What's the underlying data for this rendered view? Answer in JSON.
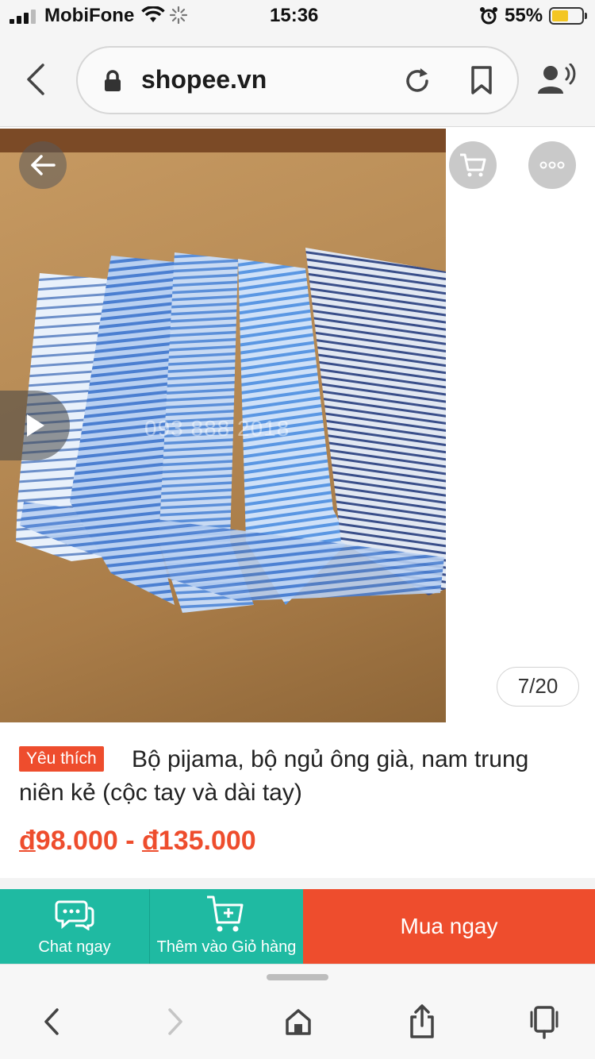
{
  "status_bar": {
    "carrier": "MobiFone",
    "time": "15:36",
    "battery_percent": "55%",
    "battery_level": 0.55,
    "icons": [
      "signal-icon",
      "wifi-icon",
      "loading-spinner-icon",
      "alarm-icon",
      "battery-icon"
    ]
  },
  "browser": {
    "url": "shopee.vn",
    "icons": [
      "back-icon",
      "lock-icon",
      "reload-icon",
      "bookmark-icon",
      "listen-icon"
    ]
  },
  "product_image": {
    "watermark": "093 888 2018",
    "counter": "7/20",
    "icons": [
      "back-arrow-icon",
      "cart-icon",
      "more-icon",
      "play-icon"
    ]
  },
  "product": {
    "badge": "Yêu thích",
    "title": "Bộ pijama, bộ ngủ ông già, nam trung niên kẻ (cộc tay và dài tay)",
    "price_low_symbol": "đ",
    "price_low": "98.000",
    "price_separator": " - ",
    "price_high_symbol": "đ",
    "price_high": "135.000"
  },
  "actions": {
    "chat_label": "Chat ngay",
    "add_to_cart_label": "Thêm vào Giỏ hàng",
    "buy_now_label": "Mua ngay"
  },
  "colors": {
    "brand_orange": "#ee4d2d",
    "teal": "#1fbaa2"
  },
  "toolbar": {
    "icons": [
      "nav-back-icon",
      "nav-forward-icon",
      "home-icon",
      "share-icon",
      "tabs-icon"
    ]
  }
}
